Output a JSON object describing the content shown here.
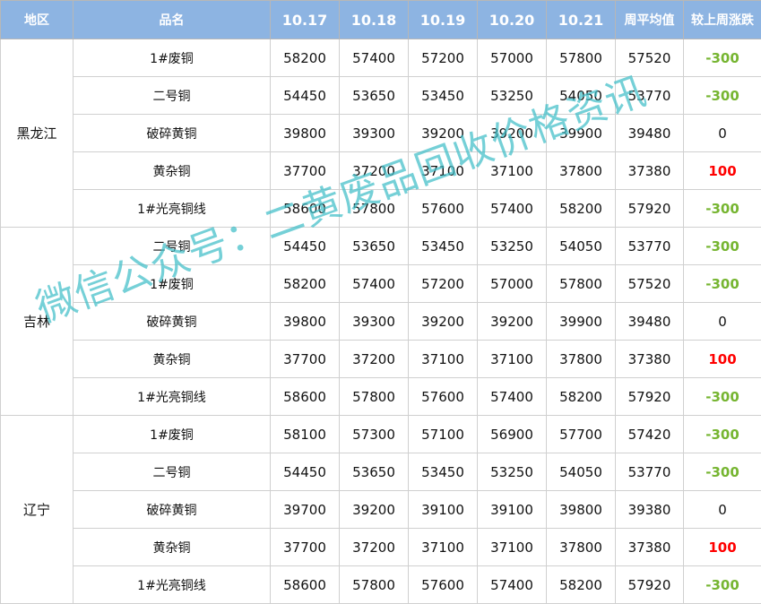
{
  "headers": {
    "region": "地区",
    "product": "品名",
    "dates": [
      "10.17",
      "10.18",
      "10.19",
      "10.20",
      "10.21"
    ],
    "avg": "周平均值",
    "change": "较上周涨跌"
  },
  "groups": [
    {
      "region": "黑龙江",
      "rows": [
        {
          "product": "1#废铜",
          "values": [
            "58200",
            "57400",
            "57200",
            "57000",
            "57800"
          ],
          "avg": "57520",
          "change": "-300"
        },
        {
          "product": "二号铜",
          "values": [
            "54450",
            "53650",
            "53450",
            "53250",
            "54050"
          ],
          "avg": "53770",
          "change": "-300"
        },
        {
          "product": "破碎黄铜",
          "values": [
            "39800",
            "39300",
            "39200",
            "39200",
            "39900"
          ],
          "avg": "39480",
          "change": "0"
        },
        {
          "product": "黄杂铜",
          "values": [
            "37700",
            "37200",
            "37100",
            "37100",
            "37800"
          ],
          "avg": "37380",
          "change": "100"
        },
        {
          "product": "1#光亮铜线",
          "values": [
            "58600",
            "57800",
            "57600",
            "57400",
            "58200"
          ],
          "avg": "57920",
          "change": "-300"
        }
      ]
    },
    {
      "region": "吉林",
      "rows": [
        {
          "product": "二号铜",
          "values": [
            "54450",
            "53650",
            "53450",
            "53250",
            "54050"
          ],
          "avg": "53770",
          "change": "-300"
        },
        {
          "product": "1#废铜",
          "values": [
            "58200",
            "57400",
            "57200",
            "57000",
            "57800"
          ],
          "avg": "57520",
          "change": "-300"
        },
        {
          "product": "破碎黄铜",
          "values": [
            "39800",
            "39300",
            "39200",
            "39200",
            "39900"
          ],
          "avg": "39480",
          "change": "0"
        },
        {
          "product": "黄杂铜",
          "values": [
            "37700",
            "37200",
            "37100",
            "37100",
            "37800"
          ],
          "avg": "37380",
          "change": "100"
        },
        {
          "product": "1#光亮铜线",
          "values": [
            "58600",
            "57800",
            "57600",
            "57400",
            "58200"
          ],
          "avg": "57920",
          "change": "-300"
        }
      ]
    },
    {
      "region": "辽宁",
      "rows": [
        {
          "product": "1#废铜",
          "values": [
            "58100",
            "57300",
            "57100",
            "56900",
            "57700"
          ],
          "avg": "57420",
          "change": "-300"
        },
        {
          "product": "二号铜",
          "values": [
            "54450",
            "53650",
            "53450",
            "53250",
            "54050"
          ],
          "avg": "53770",
          "change": "-300"
        },
        {
          "product": "破碎黄铜",
          "values": [
            "39700",
            "39200",
            "39100",
            "39100",
            "39800"
          ],
          "avg": "39380",
          "change": "0"
        },
        {
          "product": "黄杂铜",
          "values": [
            "37700",
            "37200",
            "37100",
            "37100",
            "37800"
          ],
          "avg": "37380",
          "change": "100"
        },
        {
          "product": "1#光亮铜线",
          "values": [
            "58600",
            "57800",
            "57600",
            "57400",
            "58200"
          ],
          "avg": "57920",
          "change": "-300"
        }
      ]
    }
  ],
  "watermark": "微信公众号：二黄废品回收价格资讯",
  "colors": {
    "header_bg": "#8db4e2",
    "negative": "#76b531",
    "positive": "#ff0000",
    "watermark": "#40bec8"
  }
}
